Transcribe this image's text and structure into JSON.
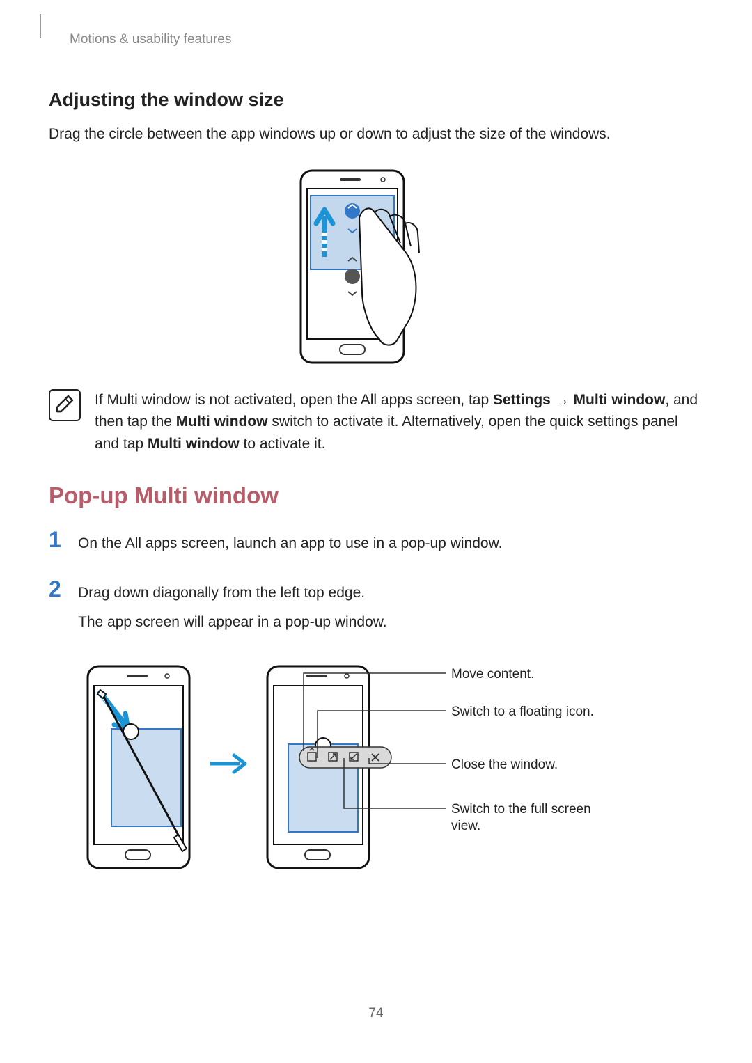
{
  "breadcrumb": "Motions & usability features",
  "subsection_heading": "Adjusting the window size",
  "subsection_body": "Drag the circle between the app windows up or down to adjust the size of the windows.",
  "note": {
    "p1a": "If Multi window is not activated, open the All apps screen, tap ",
    "settings": "Settings",
    "arrow": " → ",
    "multiwindow1": "Multi window",
    "p1b": ", and then tap the ",
    "multiwindow2": "Multi window",
    "p1c": " switch to activate it. Alternatively, open the quick settings panel and tap ",
    "multiwindow3": "Multi window",
    "p1d": " to activate it."
  },
  "section_heading": "Pop-up Multi window",
  "steps": {
    "s1": {
      "num": "1",
      "text": "On the All apps screen, launch an app to use in a pop-up window."
    },
    "s2": {
      "num": "2",
      "text1": "Drag down diagonally from the left top edge.",
      "text2": "The app screen will appear in a pop-up window."
    }
  },
  "callouts": {
    "c1": "Move content.",
    "c2": "Switch to a floating icon.",
    "c3": "Close the window.",
    "c4": "Switch to the full screen view."
  },
  "page_number": "74"
}
